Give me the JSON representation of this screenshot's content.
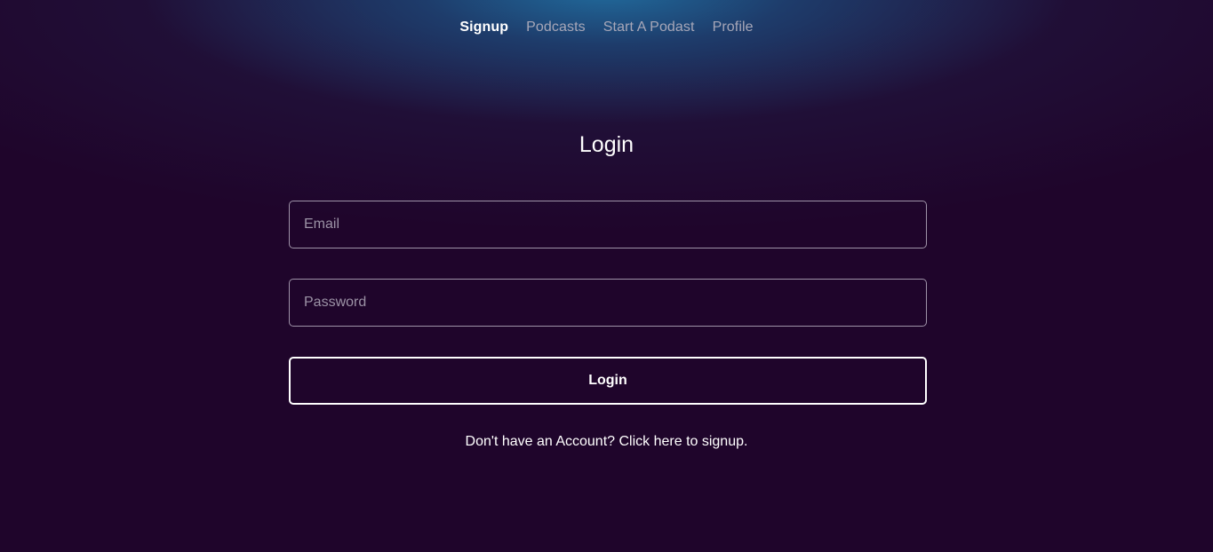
{
  "nav": {
    "items": [
      {
        "label": "Signup",
        "active": true
      },
      {
        "label": "Podcasts",
        "active": false
      },
      {
        "label": "Start A Podast",
        "active": false
      },
      {
        "label": "Profile",
        "active": false
      }
    ]
  },
  "login": {
    "title": "Login",
    "email_placeholder": "Email",
    "email_value": "",
    "password_placeholder": "Password",
    "password_value": "",
    "button_label": "Login",
    "signup_text": "Don't have an Account? Click here to signup."
  },
  "colors": {
    "background": "#1f052b",
    "glow": "#206ea0",
    "nav_inactive": "#a7a7b8",
    "input_border": "#9e93a8",
    "text": "#ffffff"
  }
}
